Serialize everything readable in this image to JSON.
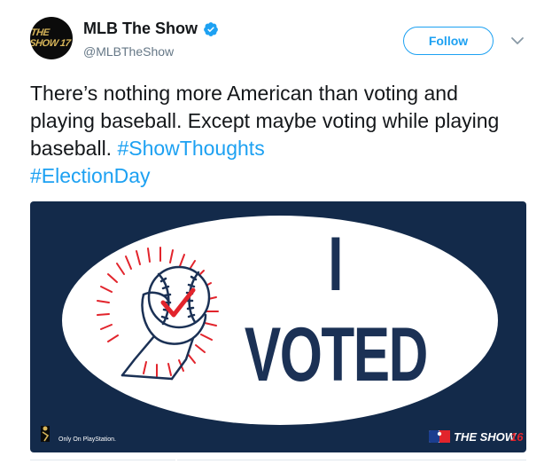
{
  "account": {
    "display_name": "MLB The Show",
    "handle": "@MLBTheShow",
    "avatar_text": "THE SHOW 17",
    "verified": true
  },
  "actions": {
    "follow_label": "Follow"
  },
  "tweet": {
    "text_plain": "There’s nothing more American than voting and playing baseball. Except maybe voting while playing baseball. ",
    "hashtags": [
      "#ShowThoughts",
      "#ElectionDay"
    ]
  },
  "media": {
    "sticker_line1": "I",
    "sticker_line2": "VOTED",
    "footer_left": "Only On PlayStation.",
    "footer_right_prefix": "THE SHOW",
    "footer_right_suffix": "16"
  },
  "colors": {
    "link": "#1da1f2",
    "media_background": "#132a4a",
    "sticker_text": "#1b3155",
    "accent_red": "#e2242c",
    "follow_border": "#1da1f2"
  }
}
